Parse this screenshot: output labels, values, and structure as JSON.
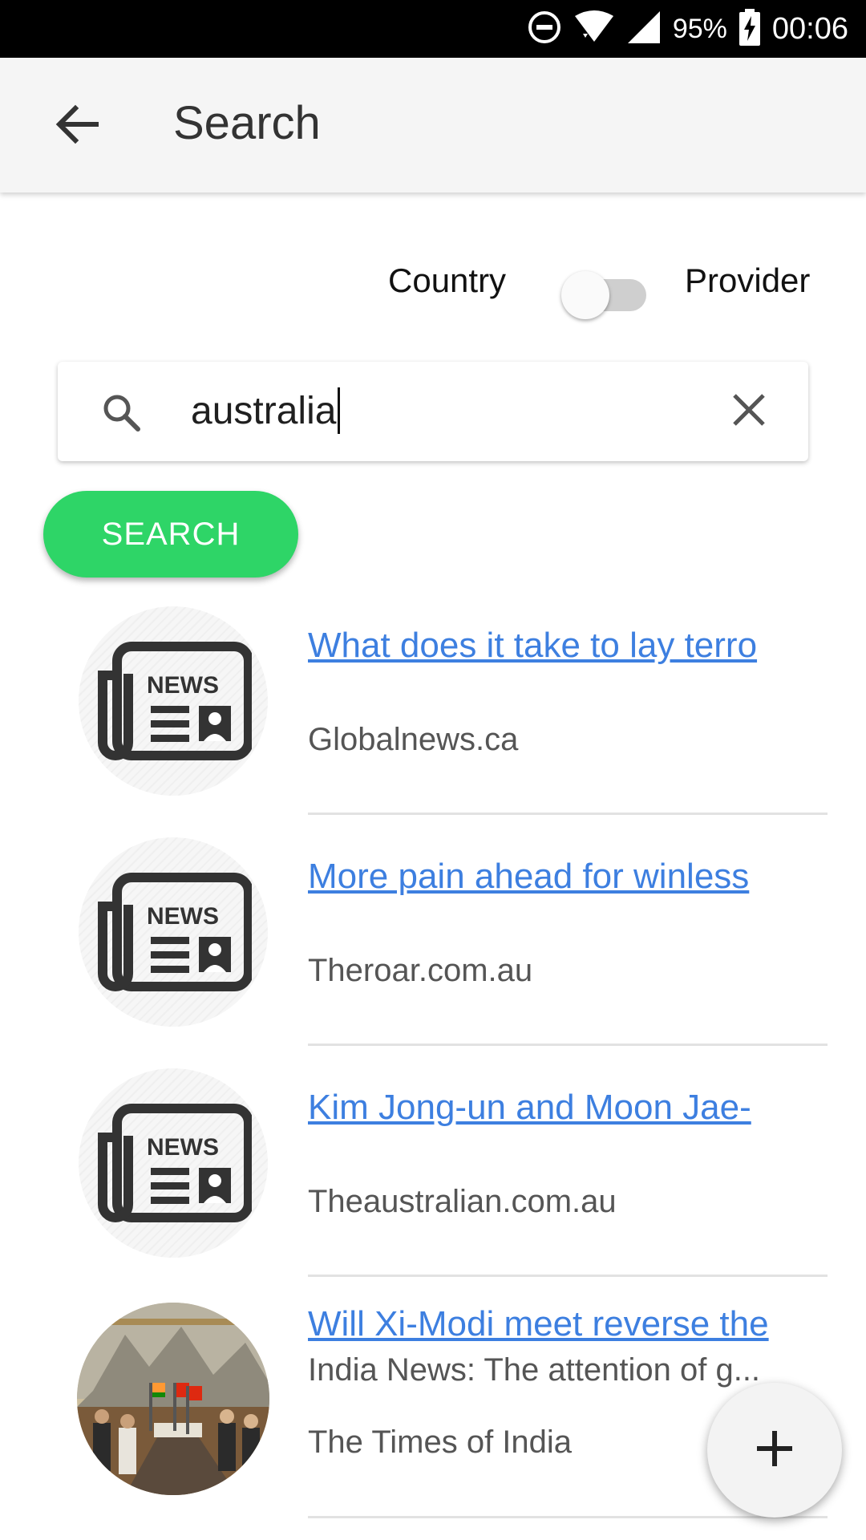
{
  "status_bar": {
    "battery_percent": "95%",
    "time": "00:06",
    "icons": [
      "do-not-disturb-icon",
      "wifi-icon",
      "signal-icon",
      "battery-charging-icon"
    ]
  },
  "app_bar": {
    "back_icon": "arrow-back-icon",
    "title": "Search"
  },
  "filter": {
    "left_label": "Country",
    "right_label": "Provider",
    "toggle_on": false
  },
  "search": {
    "value": "australia",
    "search_icon": "search-icon",
    "clear_icon": "close-icon",
    "button_label": "SEARCH"
  },
  "results": [
    {
      "title": "What does it take to lay terro",
      "description": "",
      "source": "Globalnews.ca",
      "thumbnail": "news-icon"
    },
    {
      "title": "More pain ahead for winless",
      "description": "",
      "source": "Theroar.com.au",
      "thumbnail": "news-icon"
    },
    {
      "title": "Kim Jong-un and Moon Jae-",
      "description": "",
      "source": "Theaustralian.com.au",
      "thumbnail": "news-icon"
    },
    {
      "title": "Will Xi-Modi meet reverse the",
      "description": "India News: The attention of g...",
      "source": "The Times of India",
      "thumbnail": "photo"
    }
  ],
  "fab": {
    "icon": "plus-icon"
  },
  "colors": {
    "accent_green": "#2ed567",
    "link_blue": "#3d7fe0",
    "app_bar_bg": "#f5f5f5"
  }
}
